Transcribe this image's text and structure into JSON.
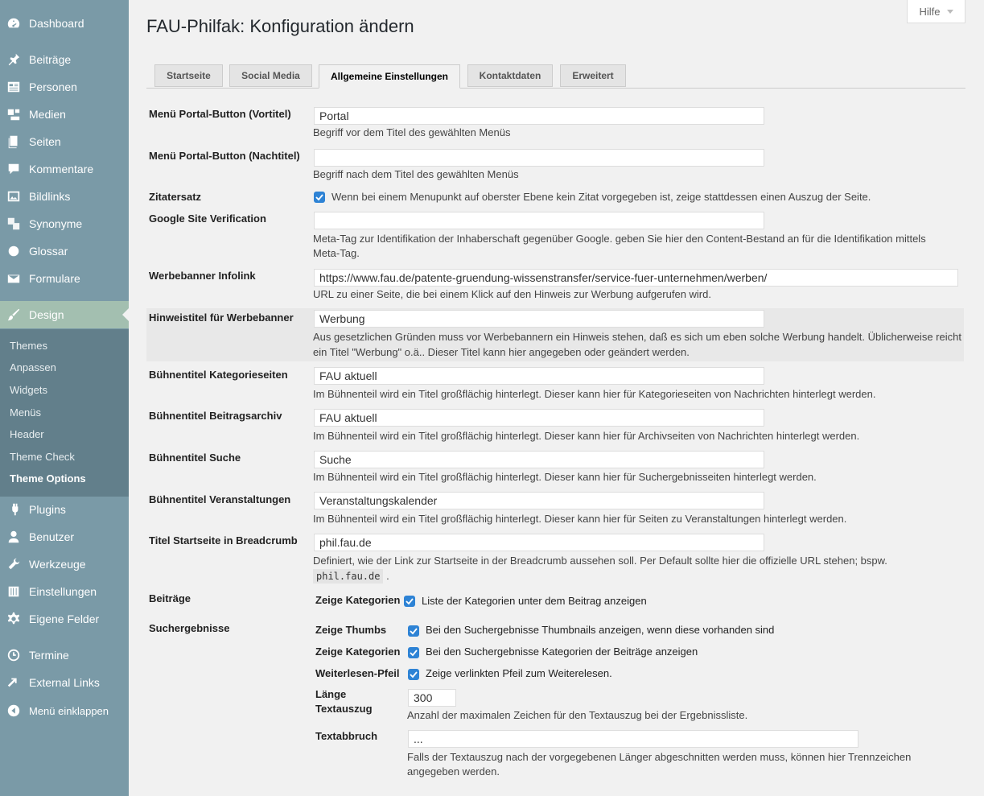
{
  "sidebar": {
    "items": [
      {
        "label": "Dashboard",
        "icon": "dashboard-icon"
      },
      {
        "label": "Beiträge",
        "icon": "pin-icon"
      },
      {
        "label": "Personen",
        "icon": "id-card-icon"
      },
      {
        "label": "Medien",
        "icon": "media-icon"
      },
      {
        "label": "Seiten",
        "icon": "pages-icon"
      },
      {
        "label": "Kommentare",
        "icon": "comment-icon"
      },
      {
        "label": "Bildlinks",
        "icon": "image-link-icon"
      },
      {
        "label": "Synonyme",
        "icon": "translate-icon"
      },
      {
        "label": "Glossar",
        "icon": "help-circle-icon"
      },
      {
        "label": "Formulare",
        "icon": "mail-icon"
      },
      {
        "label": "Design",
        "icon": "brush-icon"
      },
      {
        "label": "Plugins",
        "icon": "plug-icon"
      },
      {
        "label": "Benutzer",
        "icon": "user-icon"
      },
      {
        "label": "Werkzeuge",
        "icon": "wrench-icon"
      },
      {
        "label": "Einstellungen",
        "icon": "settings-sliders-icon"
      },
      {
        "label": "Eigene Felder",
        "icon": "gear-icon"
      },
      {
        "label": "Termine",
        "icon": "clock-icon"
      },
      {
        "label": "External Links",
        "icon": "external-link-icon"
      },
      {
        "label": "Menü einklappen",
        "icon": "collapse-icon"
      }
    ],
    "submenu": [
      "Themes",
      "Anpassen",
      "Widgets",
      "Menüs",
      "Header",
      "Theme Check",
      "Theme Options"
    ]
  },
  "header": {
    "title": "FAU-Philfak: Konfiguration ändern",
    "help": "Hilfe"
  },
  "tabs": [
    "Startseite",
    "Social Media",
    "Allgemeine Einstellungen",
    "Kontaktdaten",
    "Erweitert"
  ],
  "form": {
    "portal_vor": {
      "label": "Menü Portal-Button (Vortitel)",
      "value": "Portal",
      "desc": "Begriff vor dem Titel des gewählten Menüs"
    },
    "portal_nach": {
      "label": "Menü Portal-Button (Nachtitel)",
      "value": "",
      "desc": "Begriff nach dem Titel des gewählten Menüs"
    },
    "zitatersatz": {
      "label": "Zitatersatz",
      "text": "Wenn bei einem Menupunkt auf oberster Ebene kein Zitat vorgegeben ist, zeige stattdessen einen Auszug der Seite."
    },
    "google": {
      "label": "Google Site Verification",
      "value": "",
      "desc1": "Meta-Tag zur Identifikation der Inhaberschaft gegenüber Google. geben Sie hier den Content-Bestand an für die Identifikation mittels",
      "desc2": "Meta-Tag."
    },
    "werbebanner": {
      "label": "Werbebanner Infolink",
      "value": "https://www.fau.de/patente-gruendung-wissenstransfer/service-fuer-unternehmen/werben/",
      "desc": "URL zu einer Seite, die bei einem Klick auf den Hinweis zur Werbung aufgerufen wird."
    },
    "hinweistitel": {
      "label": "Hinweistitel für Werbebanner",
      "value": "Werbung",
      "desc1": "Aus gesetzlichen Gründen muss vor Werbebannern ein Hinweis stehen, daß es sich um eben solche Werbung handelt. Üblicherweise reicht",
      "desc2": "ein Titel \"Werbung\" o.ä.. Dieser Titel kann hier angegeben oder geändert werden."
    },
    "buehne_kat": {
      "label": "Bühnentitel Kategorieseiten",
      "value": "FAU aktuell",
      "desc": "Im Bühnenteil wird ein Titel großflächig hinterlegt. Dieser kann hier für Kategorieseiten von Nachrichten hinterlegt werden."
    },
    "buehne_archiv": {
      "label": "Bühnentitel Beitragsarchiv",
      "value": "FAU aktuell",
      "desc": "Im Bühnenteil wird ein Titel großflächig hinterlegt. Dieser kann hier für Archivseiten von Nachrichten hinterlegt werden."
    },
    "buehne_suche": {
      "label": "Bühnentitel Suche",
      "value": "Suche",
      "desc": "Im Bühnenteil wird ein Titel großflächig hinterlegt. Dieser kann hier für Suchergebnisseiten hinterlegt werden."
    },
    "buehne_va": {
      "label": "Bühnentitel Veranstaltungen",
      "value": "Veranstaltungskalender",
      "desc": "Im Bühnenteil wird ein Titel großflächig hinterlegt. Dieser kann hier für Seiten zu Veranstaltungen hinterlegt werden."
    },
    "breadcrumb": {
      "label": "Titel Startseite in Breadcrumb",
      "value": "phil.fau.de",
      "desc": "Definiert, wie der Link zur Startseite in der Breadcrumb aussehen soll. Per Default sollte hier die offizielle URL stehen; bspw.",
      "code": "phil.fau.de",
      "suffix": "."
    },
    "beitraege": {
      "label": "Beiträge",
      "sublabel": "Zeige Kategorien",
      "text": "Liste der Kategorien unter dem Beitrag anzeigen"
    },
    "suchergebnisse": {
      "label": "Suchergebnisse",
      "thumbs": {
        "sublabel": "Zeige Thumbs",
        "text": "Bei den Suchergebnisse Thumbnails anzeigen, wenn diese vorhanden sind"
      },
      "kategorien": {
        "sublabel": "Zeige Kategorien",
        "text": "Bei den Suchergebnisse Kategorien der Beiträge anzeigen"
      },
      "pfeil": {
        "sublabel": "Weiterlesen-Pfeil",
        "text": "Zeige verlinkten Pfeil zum Weiterelesen."
      },
      "laenge": {
        "sublabel1": "Länge",
        "sublabel2": "Textauszug",
        "value": "300",
        "desc": "Anzahl der maximalen Zeichen für den Textauszug bei der Ergebnissliste."
      },
      "abbruch": {
        "sublabel": "Textabbruch",
        "value": "...",
        "desc1": "Falls der Textauszug nach der vorgegebenen Länger abgeschnitten werden muss, können hier Trennzeichen",
        "desc2": "angegeben werden."
      }
    }
  }
}
